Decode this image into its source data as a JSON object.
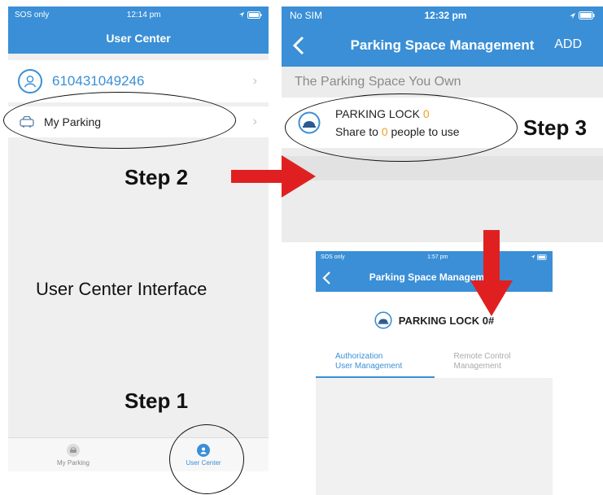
{
  "colors": {
    "primary": "#3a8fd6",
    "accent_red": "#e02020",
    "highlight_orange": "#f0a020"
  },
  "screen1": {
    "status": {
      "carrier": "SOS only",
      "time": "12:14 pm"
    },
    "title": "User Center",
    "user_id": "610431049246",
    "my_parking_label": "My Parking",
    "tabs": [
      {
        "label": "My Parking",
        "icon": "car-icon"
      },
      {
        "label": "User Center",
        "icon": "person-icon"
      }
    ]
  },
  "screen2": {
    "status": {
      "carrier": "No SIM",
      "time": "12:32 pm"
    },
    "title": "Parking Space Management",
    "add_label": "ADD",
    "section_header": "The Parking Space You Own",
    "lock": {
      "name_prefix": "PARKING LOCK",
      "count": "0",
      "share_prefix": "Share to",
      "share_count": "0",
      "share_suffix": "people to use"
    }
  },
  "screen3": {
    "status": {
      "carrier": "SOS only",
      "time": "1:57 pm"
    },
    "title": "Parking Space Management",
    "lock_name": "PARKING LOCK 0#",
    "tabs": [
      {
        "line1": "Authorization",
        "line2": "User Management"
      },
      {
        "line1": "Remote Control",
        "line2": "Management"
      }
    ]
  },
  "captions": {
    "interface": "User Center Interface",
    "step1": "Step 1",
    "step2": "Step 2",
    "step3": "Step 3"
  }
}
